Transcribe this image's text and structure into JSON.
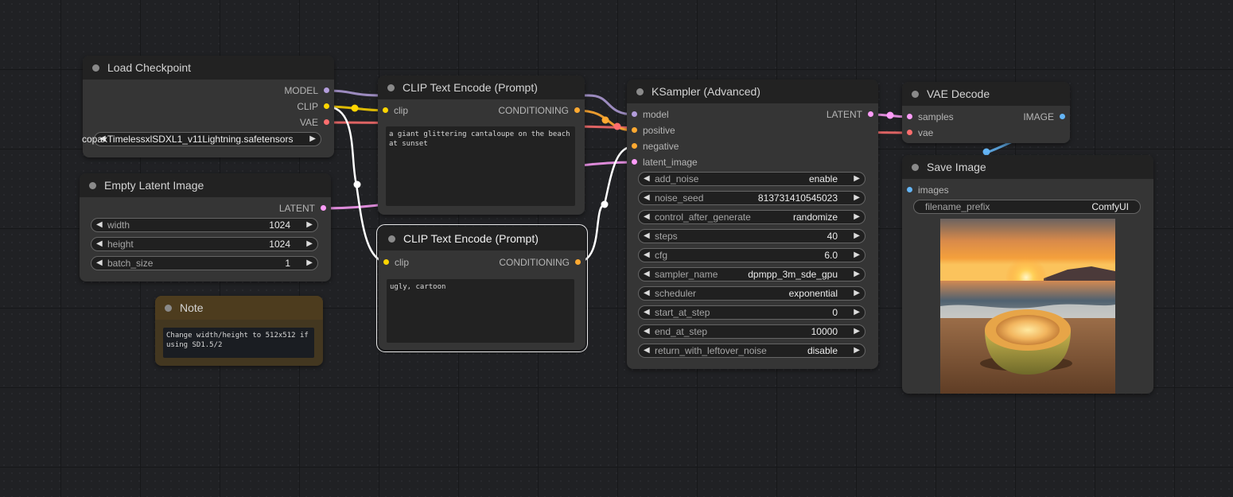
{
  "colors": {
    "model": "#b39ddb",
    "clip": "#ffd500",
    "vae": "#ff6e6e",
    "latent": "#ff9cf9",
    "conditioning": "#ffa931",
    "image": "#64b5f6",
    "link_white": "#ffffff"
  },
  "load_checkpoint": {
    "title": "Load Checkpoint",
    "outputs": [
      "MODEL",
      "CLIP",
      "VAE"
    ],
    "ckpt_name_widget": "copaxTimelessxlSDXL1_v11Lightning.safetensors"
  },
  "empty_latent": {
    "title": "Empty Latent Image",
    "output": "LATENT",
    "widgets": [
      {
        "label": "width",
        "value": "1024"
      },
      {
        "label": "height",
        "value": "1024"
      },
      {
        "label": "batch_size",
        "value": "1"
      }
    ]
  },
  "note": {
    "title": "Note",
    "text": "Change width/height to 512x512 if using SD1.5/2"
  },
  "clip_pos": {
    "title": "CLIP Text Encode (Prompt)",
    "input": "clip",
    "output": "CONDITIONING",
    "text": "a giant glittering cantaloupe on the beach at sunset"
  },
  "clip_neg": {
    "title": "CLIP Text Encode (Prompt)",
    "input": "clip",
    "output": "CONDITIONING",
    "text": "ugly, cartoon"
  },
  "ksampler": {
    "title": "KSampler (Advanced)",
    "inputs": [
      "model",
      "positive",
      "negative",
      "latent_image"
    ],
    "output": "LATENT",
    "widgets": [
      {
        "label": "add_noise",
        "value": "enable"
      },
      {
        "label": "noise_seed",
        "value": "813731410545023"
      },
      {
        "label": "control_after_generate",
        "value": "randomize"
      },
      {
        "label": "steps",
        "value": "40"
      },
      {
        "label": "cfg",
        "value": "6.0"
      },
      {
        "label": "sampler_name",
        "value": "dpmpp_3m_sde_gpu"
      },
      {
        "label": "scheduler",
        "value": "exponential"
      },
      {
        "label": "start_at_step",
        "value": "0"
      },
      {
        "label": "end_at_step",
        "value": "10000"
      },
      {
        "label": "return_with_leftover_noise",
        "value": "disable"
      }
    ]
  },
  "vae_decode": {
    "title": "VAE Decode",
    "inputs": [
      "samples",
      "vae"
    ],
    "output": "IMAGE"
  },
  "save_image": {
    "title": "Save Image",
    "input": "images",
    "filename_prefix_label": "filename_prefix",
    "filename_prefix_value": "ComfyUI"
  }
}
